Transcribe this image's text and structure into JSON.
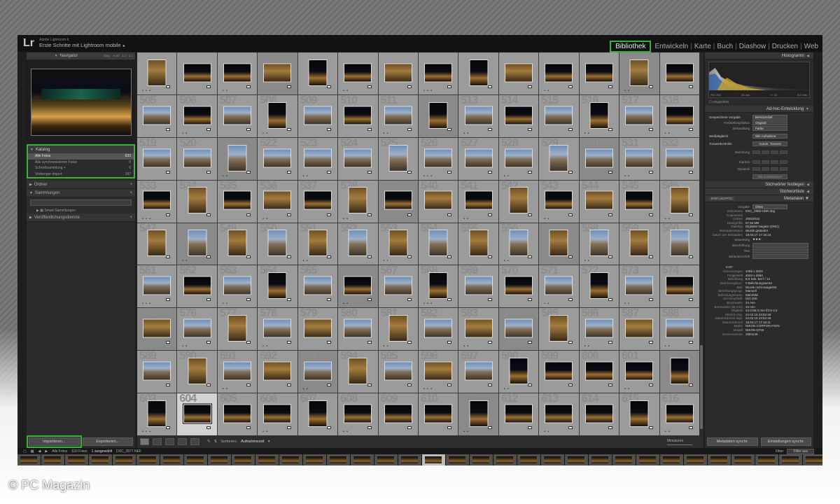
{
  "app": {
    "logo": "Lr",
    "product": "Adobe Lightroom 6",
    "catalog_title": "Erste Schritte mit Lightroom mobile",
    "catalog_arrow": "▸"
  },
  "modules": {
    "items": [
      "Bibliothek",
      "Entwickeln",
      "Karte",
      "Buch",
      "Diashow",
      "Drucken",
      "Web"
    ],
    "active_index": 0
  },
  "navigator": {
    "label": "Navigator",
    "zoom_opts": [
      "Einp.",
      "Ausf.",
      "1:1",
      "1:1"
    ]
  },
  "katalog": {
    "label": "Katalog",
    "rows": [
      {
        "label": "Alle Fotos",
        "count": "633",
        "selected": true
      },
      {
        "label": "Alle synchronisierten Fotos",
        "count": "0"
      },
      {
        "label": "Schnellsammlung +",
        "count": "0"
      },
      {
        "label": "Vorheriger Import",
        "count": "197"
      }
    ]
  },
  "left_panels": {
    "ordner": "Ordner",
    "sammlungen": "Sammlungen",
    "smart_sammlungen": "Smart-Sammlungen",
    "veroeffentlichung": "Veröffentlichungsdienste",
    "plus": "+"
  },
  "left_buttons": {
    "import": "Importieren...",
    "export": "Exportieren..."
  },
  "grid": {
    "numbers": [
      "",
      "",
      "",
      "",
      "",
      "",
      "",
      "",
      "",
      "",
      "",
      "",
      "",
      "",
      "505",
      "506",
      "507",
      "508",
      "509",
      "510",
      "511",
      "512",
      "513",
      "514",
      "515",
      "516",
      "517",
      "518",
      "519",
      "520",
      "521",
      "522",
      "523",
      "524",
      "525",
      "526",
      "527",
      "528",
      "529",
      "530",
      "531",
      "532",
      "533",
      "534",
      "535",
      "536",
      "537",
      "538",
      "539",
      "540",
      "541",
      "542",
      "543",
      "544",
      "545",
      "546",
      "547",
      "548",
      "549",
      "550",
      "551",
      "552",
      "553",
      "554",
      "555",
      "556",
      "557",
      "558",
      "559",
      "560",
      "561",
      "562",
      "563",
      "564",
      "565",
      "566",
      "567",
      "568",
      "569",
      "570",
      "571",
      "572",
      "573",
      "574",
      "575",
      "576",
      "577",
      "578",
      "579",
      "580",
      "581",
      "582",
      "583",
      "584",
      "585",
      "586",
      "587",
      "588",
      "589",
      "590",
      "591",
      "592",
      "593",
      "594",
      "595",
      "596",
      "597",
      "598",
      "599",
      "600",
      "601",
      "602",
      "603",
      "604",
      "605",
      "606",
      "607",
      "608",
      "609",
      "610",
      "611",
      "612",
      "613",
      "614",
      "615",
      "616"
    ],
    "selected_index": 113,
    "stars_text": "• •",
    "stars_text3": "• • •"
  },
  "toolbar": {
    "sort_label": "Sortieren:",
    "sort_value": "Aufnahmezeit",
    "thumb_label": "Miniaturen"
  },
  "histogram": {
    "label": "Histogramm",
    "iso": "ISO 200",
    "focal": "34 mm",
    "aperture": "f / 14",
    "shutter": "8,0 Sek.",
    "original": "Originalfoto"
  },
  "adhoc": {
    "label": "Ad-hoc-Entwicklung",
    "preset_label": "Gespeicherte Vorgabe",
    "preset_value": "Benutzerdef.",
    "crop_label": "Freistellungsfaktor",
    "crop_value": "Original",
    "treat_label": "Behandlung",
    "treat_value": "Farbe",
    "wb_label": "Weißabgleich",
    "wb_value": "Wie Aufnahme",
    "tone_label": "Tonwertkontrolle",
    "auto_tone": "Autom. Tonwert",
    "exposure": "Belichtung",
    "clarity": "Klarheit",
    "vibrance": "Dynamik",
    "reset": "Alle zurücksetzen"
  },
  "keywords": {
    "label": "Stichwörter festlegen",
    "list": "Stichwortliste"
  },
  "metadata": {
    "label": "Metadaten",
    "preset_dd": "EXIF und IPTC",
    "vorgabe_label": "Vorgabe",
    "vorgabe_value": "Ohne",
    "rows_top": [
      {
        "k": "Dateiname",
        "v": "DSC_2866-HDR.dng"
      },
      {
        "k": "Kopiename",
        "v": ""
      },
      {
        "k": "Ordner",
        "v": "20022015"
      },
      {
        "k": "Dateigröße",
        "v": "57,66 MB"
      },
      {
        "k": "Dateityp",
        "v": "Digitales Negativ (DNG)"
      },
      {
        "k": "Metadatenstatus",
        "v": "Wurde geändert"
      },
      {
        "k": "Datum der Metadaten",
        "v": "18.04.17 17:16:16"
      }
    ],
    "rating_label": "Bewertung",
    "rating_value": "★★★·",
    "caption_label": "Beschriftung",
    "title_label": "Titel",
    "bildunterschrift": "Bildunterschrift",
    "exif": "EXIF",
    "rows_exif": [
      {
        "k": "Abmessungen",
        "v": "4256 x 2832"
      },
      {
        "k": "Freigestellt",
        "v": "4034 x 2684"
      },
      {
        "k": "Belichtung",
        "v": "8,0 Sek. bei f / 14"
      },
      {
        "k": "Belichtungskorr.",
        "v": "0 Belichtungswerte"
      },
      {
        "k": "Blitz",
        "v": "Wurde nicht ausgelöst"
      },
      {
        "k": "Belichtungsprogr.",
        "v": "Manuell"
      },
      {
        "k": "Belichtungsmess.",
        "v": "Mehrfeld"
      },
      {
        "k": "ISO-Empfindl.",
        "v": "ISO 200"
      },
      {
        "k": "Brennweite",
        "v": "34 mm"
      },
      {
        "k": "Brennweite (35 mm)",
        "v": "34 mm"
      },
      {
        "k": "Objektiv",
        "v": "24.0-85.0 mm f/3.5-4.5"
      },
      {
        "k": "Uhrzeit Orig.",
        "v": "24.02.15 23:52:48"
      },
      {
        "k": "Datum/Uhrzeit digit.",
        "v": "24.02.15 23:52:48"
      },
      {
        "k": "Datum/Uhrzeit",
        "v": "18.04.17 17:16:11"
      },
      {
        "k": "Marke",
        "v": "NIKON CORPORATION"
      },
      {
        "k": "Modell",
        "v": "NIKON D700"
      },
      {
        "k": "Seriennummer",
        "v": "2084146"
      }
    ],
    "sync_meta": "Metadaten synchr.",
    "sync_settings": "Einstellungen synchr."
  },
  "filmstrip": {
    "source": "Alle Fotos",
    "count": "633 Fotos",
    "sel": "1 ausgewählt",
    "file": "DSC_2877.NEF",
    "filter_label": "Filter:",
    "filter_value": "Filter aus"
  },
  "credit": "© PC Magazin",
  "colors": {
    "highlight": "#3db03a",
    "panel": "#2b2b2b",
    "grid_cell": "#9b9b9b"
  }
}
